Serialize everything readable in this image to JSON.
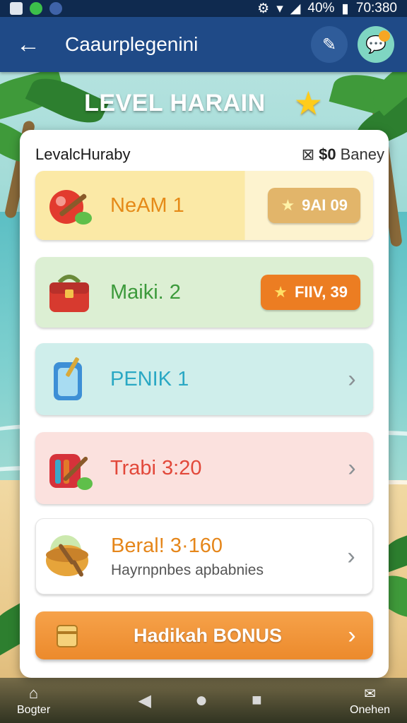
{
  "status_bar": {
    "battery": "40%",
    "time": "70:380"
  },
  "app_bar": {
    "title": "Caaurplegenini"
  },
  "banner": {
    "title": "LEVEL HARAIN"
  },
  "panel": {
    "title": "LevalcHuraby",
    "balance_amount": "$0",
    "balance_label": "Baney",
    "rows": [
      {
        "label": "NeAM 1",
        "badge": "9AI 09",
        "icon": "apple-icon"
      },
      {
        "label": "Maiki. 2",
        "badge": "FIIV, 39",
        "icon": "bag-icon"
      },
      {
        "label": "PENIK 1",
        "icon": "drink-icon"
      },
      {
        "label": "Trabi 3:20",
        "icon": "tool-bag-icon"
      },
      {
        "label": "Beral! 3·160",
        "sub": "Hayrnpnbes apbabnies",
        "icon": "bowl-icon"
      }
    ],
    "bonus_label": "Hadikah BONUS"
  },
  "nav": {
    "left_label": "Bogter",
    "right_label": "Onehen"
  },
  "colors": {
    "appbar": "#1f4a87",
    "accent_orange": "#ec8a2c",
    "star": "#ffcc1a"
  }
}
